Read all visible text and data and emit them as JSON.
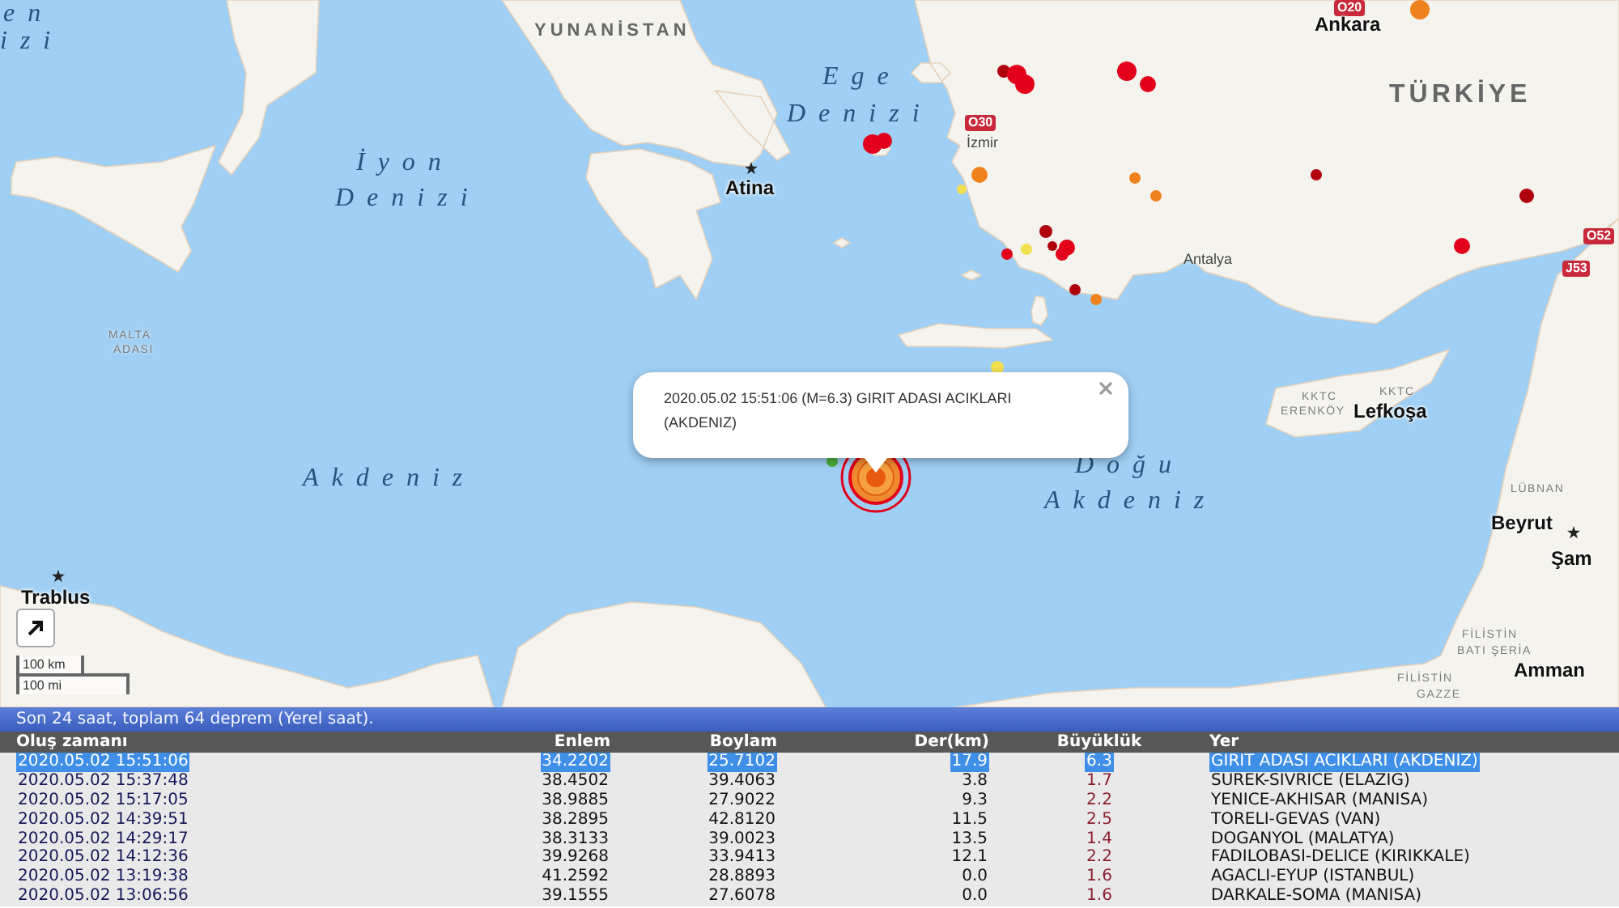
{
  "map": {
    "labels": [
      {
        "kind": "sea",
        "text": "en"
      },
      {
        "kind": "sea",
        "text": "izi"
      },
      {
        "kind": "country",
        "text": "YUNANİSTAN"
      },
      {
        "kind": "sea",
        "text": "İyon"
      },
      {
        "kind": "sea",
        "text": "Denizi"
      },
      {
        "kind": "city",
        "text": "Atina",
        "star": true
      },
      {
        "kind": "sea",
        "text": "Ege"
      },
      {
        "kind": "sea",
        "text": "Denizi"
      },
      {
        "kind": "road",
        "text": "O30"
      },
      {
        "kind": "town",
        "text": "İzmir"
      },
      {
        "kind": "road",
        "text": "O20"
      },
      {
        "kind": "city",
        "text": "Ankara",
        "star": false
      },
      {
        "kind": "country",
        "text": "TÜRKİYE"
      },
      {
        "kind": "town",
        "text": "Antalya"
      },
      {
        "kind": "road",
        "text": "O52"
      },
      {
        "kind": "road",
        "text": "J53"
      },
      {
        "kind": "region",
        "text": "MALTA"
      },
      {
        "kind": "region",
        "text": "ADASI"
      },
      {
        "kind": "sea",
        "text": "Akdeniz"
      },
      {
        "kind": "sea",
        "text": "Doğu"
      },
      {
        "kind": "sea",
        "text": "Akdeniz"
      },
      {
        "kind": "region",
        "text": "KKTC"
      },
      {
        "kind": "region",
        "text": "KKTC"
      },
      {
        "kind": "region",
        "text": "ERENKÖY"
      },
      {
        "kind": "city",
        "text": "Lefkoşa",
        "star": false
      },
      {
        "kind": "region",
        "text": "LÜBNAN"
      },
      {
        "kind": "city",
        "text": "Beyrut",
        "star": false
      },
      {
        "kind": "city",
        "text": "Şam",
        "star": true
      },
      {
        "kind": "city",
        "text": "Trablus",
        "star": true
      },
      {
        "kind": "region",
        "text": "FİLİSTİN"
      },
      {
        "kind": "region",
        "text": "BATI ŞERİA"
      },
      {
        "kind": "city",
        "text": "Amman",
        "star": false
      },
      {
        "kind": "region",
        "text": "FİLİSTİN"
      },
      {
        "kind": "region",
        "text": "GAZZE"
      }
    ],
    "markers": [
      {
        "kind": "dot",
        "color": "#f0821e"
      },
      {
        "kind": "dot",
        "color": "#b0000e"
      },
      {
        "kind": "dot",
        "color": "#e2001a"
      },
      {
        "kind": "dot",
        "color": "#e2001a"
      },
      {
        "kind": "dot",
        "color": "#e2001a"
      },
      {
        "kind": "dot",
        "color": "#e2001a"
      },
      {
        "kind": "dot",
        "color": "#e2001a"
      },
      {
        "kind": "dot",
        "color": "#e2001a"
      },
      {
        "kind": "dot",
        "color": "#f0821e"
      },
      {
        "kind": "dot",
        "color": "#f2e050"
      },
      {
        "kind": "dot",
        "color": "#f0821e"
      },
      {
        "kind": "dot",
        "color": "#f0821e"
      },
      {
        "kind": "dot",
        "color": "#b0000e"
      },
      {
        "kind": "dot",
        "color": "#b0000e"
      },
      {
        "kind": "dot",
        "color": "#e2001a"
      },
      {
        "kind": "dot",
        "color": "#b0000e"
      },
      {
        "kind": "dot",
        "color": "#b0000e"
      },
      {
        "kind": "dot",
        "color": "#e2001a"
      },
      {
        "kind": "dot",
        "color": "#e2001a"
      },
      {
        "kind": "dot",
        "color": "#e2001a"
      },
      {
        "kind": "dot",
        "color": "#f2e050"
      },
      {
        "kind": "dot",
        "color": "#b0000e"
      },
      {
        "kind": "dot",
        "color": "#f0821e"
      },
      {
        "kind": "dot",
        "color": "#f2e050"
      },
      {
        "kind": "dot",
        "color": "#4caf3c"
      },
      {
        "kind": "ring",
        "color": "#e2001a"
      }
    ],
    "popup": {
      "text": "2020.05.02 15:51:06 (M=6.3) GIRIT ADASI ACIKLARI (AKDENIZ)"
    },
    "scale": {
      "metric": "100 km",
      "imperial": "100 mi"
    }
  },
  "table": {
    "caption": "Son 24 saat, toplam 64 deprem (Yerel saat).",
    "columns": [
      "Oluş zamanı",
      "Enlem",
      "Boylam",
      "Der(km)",
      "Büyüklük",
      "Yer"
    ],
    "rows": [
      {
        "selected": true,
        "cells": [
          "2020.05.02 15:51:06",
          "34.2202",
          "25.7102",
          "17.9",
          "6.3",
          "GIRIT ADASI ACIKLARI (AKDENIZ)"
        ]
      },
      {
        "selected": false,
        "cells": [
          "2020.05.02 15:37:48",
          "38.4502",
          "39.4063",
          "3.8",
          "1.7",
          "SUREK-SIVRICE (ELAZIG)"
        ]
      },
      {
        "selected": false,
        "cells": [
          "2020.05.02 15:17:05",
          "38.9885",
          "27.9022",
          "9.3",
          "2.2",
          "YENICE-AKHISAR (MANISA)"
        ]
      },
      {
        "selected": false,
        "cells": [
          "2020.05.02 14:39:51",
          "38.2895",
          "42.8120",
          "11.5",
          "2.5",
          "TORELI-GEVAS (VAN)"
        ]
      },
      {
        "selected": false,
        "cells": [
          "2020.05.02 14:29:17",
          "38.3133",
          "39.0023",
          "13.5",
          "1.4",
          "DOGANYOL (MALATYA)"
        ]
      },
      {
        "selected": false,
        "cells": [
          "2020.05.02 14:12:36",
          "39.9268",
          "33.9413",
          "12.1",
          "2.2",
          "FADILOBASI-DELICE (KIRIKKALE)"
        ]
      },
      {
        "selected": false,
        "cells": [
          "2020.05.02 13:19:38",
          "41.2592",
          "28.8893",
          "0.0",
          "1.6",
          "AGACLI-EYUP (ISTANBUL)"
        ]
      },
      {
        "selected": false,
        "cells": [
          "2020.05.02 13:06:56",
          "39.1555",
          "27.6078",
          "0.0",
          "1.6",
          "DARKALE-SOMA (MANISA)"
        ]
      }
    ]
  }
}
